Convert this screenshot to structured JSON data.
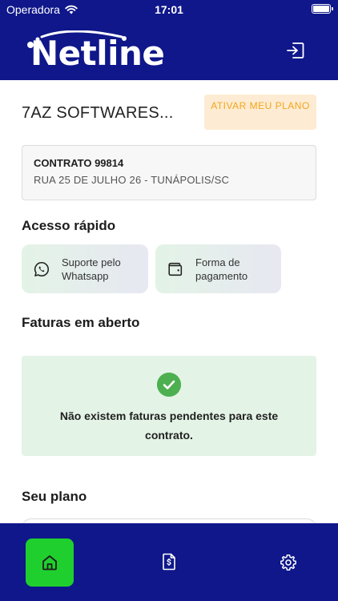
{
  "status_bar": {
    "carrier": "Operadora",
    "time": "17:01"
  },
  "header": {
    "brand": "Netline",
    "logout_icon": "logout-icon"
  },
  "company": {
    "name": "7AZ SOFTWARES...",
    "activate_label": "ATIVAR MEU PLANO"
  },
  "contract": {
    "title": "CONTRATO 99814",
    "address": "RUA 25 DE JULHO 26 - TUNÁPOLIS/SC"
  },
  "quick_access": {
    "title": "Acesso rápido",
    "items": [
      {
        "label": "Suporte pelo Whatsapp",
        "icon": "whatsapp-icon"
      },
      {
        "label": "Forma de pagamento",
        "icon": "wallet-icon"
      }
    ]
  },
  "invoices": {
    "title": "Faturas em aberto",
    "empty_message": "Não existem faturas pendentes para este contrato."
  },
  "plan": {
    "title": "Seu plano"
  },
  "tab_bar": {
    "items": [
      {
        "icon": "home-icon",
        "active": true
      },
      {
        "icon": "invoice-icon",
        "active": false
      },
      {
        "icon": "gear-icon",
        "active": false
      }
    ]
  },
  "colors": {
    "primary": "#0f178a",
    "accent_green": "#1fcf2e",
    "success_bg": "#e3f3e6",
    "warning_bg": "#fdecd3",
    "warning_text": "#f4a51c"
  }
}
